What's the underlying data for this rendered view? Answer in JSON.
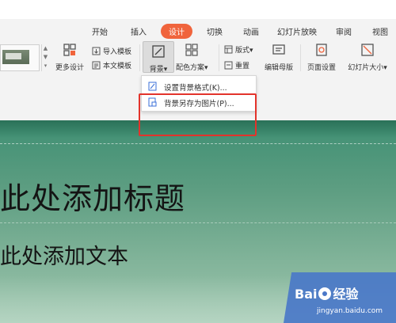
{
  "tabs": [
    "开始",
    "插入",
    "设计",
    "切换",
    "动画",
    "幻灯片放映",
    "审阅",
    "视图"
  ],
  "active_tab": "设计",
  "colors": {
    "accent": "#f0643c",
    "highlight": "#e3332b",
    "slide_green": "#4f967a",
    "watermark_blue": "#4a78c8"
  },
  "toolbar": {
    "more_design": "更多设计",
    "import_template": "导入模板",
    "text_template": "本文模板",
    "background": "背景",
    "color_scheme": "配色方案",
    "layout": "版式",
    "reset": "重置",
    "edit_master": "编辑母版",
    "page_setup": "页面设置",
    "slide_size": "幻灯片大小"
  },
  "menu": {
    "items": [
      "设置背景格式(K)...",
      "背景另存为图片(P)..."
    ]
  },
  "slide": {
    "title": "此处添加标题",
    "subtitle": "此处添加文本"
  },
  "watermark": {
    "brand": "Bai",
    "brand2": "经验",
    "url": "jingyan.baidu.com"
  },
  "icons": [
    "more-design-icon",
    "import-template-icon",
    "text-template-icon",
    "background-icon",
    "color-scheme-icon",
    "layout-icon",
    "reset-icon",
    "edit-master-icon",
    "page-setup-icon",
    "slide-size-icon",
    "bg-format-icon",
    "save-bg-image-icon"
  ]
}
